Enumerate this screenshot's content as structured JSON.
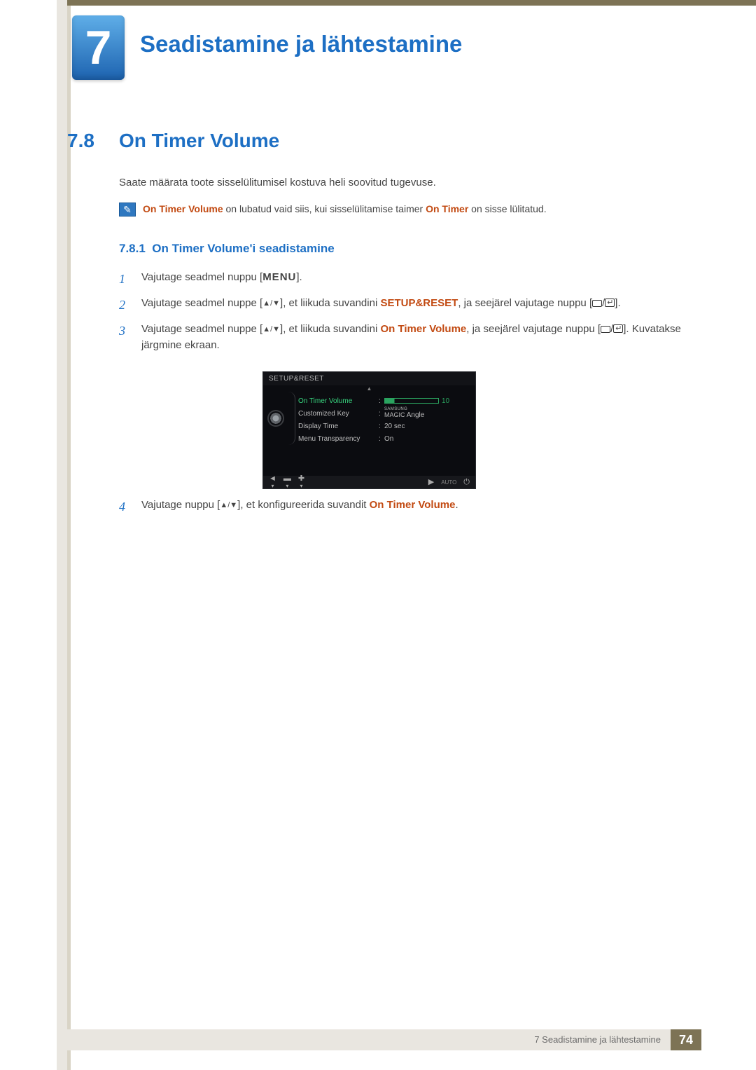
{
  "chapter": {
    "number": "7",
    "title": "Seadistamine ja lähtestamine"
  },
  "section": {
    "number": "7.8",
    "title": "On Timer Volume"
  },
  "intro": "Saate määrata toote sisselülitumisel kostuva heli soovitud tugevuse.",
  "note": {
    "term1": "On Timer Volume",
    "mid1": " on lubatud vaid siis, kui sisselülitamise taimer ",
    "term2": "On Timer",
    "end": " on sisse lülitatud."
  },
  "subsection": {
    "number": "7.8.1",
    "title": "On Timer Volume'i seadistamine"
  },
  "steps": {
    "s1": {
      "num": "1",
      "a": "Vajutage seadmel nuppu [",
      "menu": "MENU",
      "b": "]."
    },
    "s2": {
      "num": "2",
      "a": "Vajutage seadmel nuppe [",
      "arrows": "▲/▼",
      "b": "], et liikuda suvandini ",
      "hl": "SETUP&RESET",
      "c": ", ja seejärel vajutage nuppu [",
      "d": "]."
    },
    "s3": {
      "num": "3",
      "a": "Vajutage seadmel nuppe [",
      "arrows": "▲/▼",
      "b": "], et liikuda suvandini ",
      "hl": "On Timer Volume",
      "c": ", ja seejärel vajutage nuppu [",
      "d": "]. Kuvatakse järgmine ekraan."
    },
    "s4": {
      "num": "4",
      "a": "Vajutage nuppu [",
      "arrows": "▲/▼",
      "b": "], et konfigureerida suvandit ",
      "hl": "On Timer Volume",
      "c": "."
    }
  },
  "osd": {
    "title": "SETUP&RESET",
    "rows": {
      "r1": {
        "label": "On Timer Volume",
        "value": "10"
      },
      "r2": {
        "label": "Customized Key",
        "value_top": "SAMSUNG",
        "value_main": "MAGIC",
        "value_suffix": " Angle"
      },
      "r3": {
        "label": "Display Time",
        "value": "20 sec"
      },
      "r4": {
        "label": "Menu Transparency",
        "value": "On"
      }
    },
    "footer": {
      "auto": "AUTO"
    }
  },
  "footer": {
    "label": "7 Seadistamine ja lähtestamine",
    "page": "74"
  }
}
